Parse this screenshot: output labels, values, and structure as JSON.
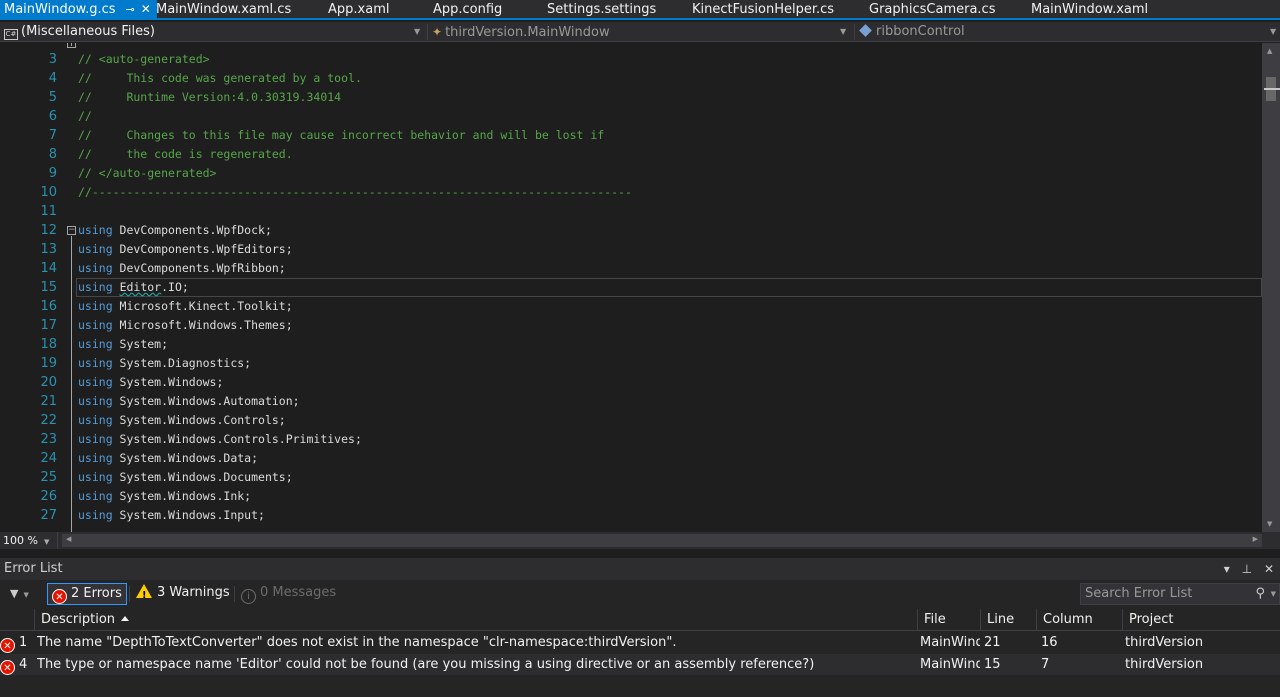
{
  "tabs": [
    {
      "label": "MainWindow.g.cs",
      "active": true
    },
    {
      "label": "MainWindow.xaml.cs"
    },
    {
      "label": "App.xaml"
    },
    {
      "label": "App.config"
    },
    {
      "label": "Settings.settings"
    },
    {
      "label": "KinectFusionHelper.cs"
    },
    {
      "label": "GraphicsCamera.cs"
    },
    {
      "label": "MainWindow.xaml"
    }
  ],
  "tab_pin_glyph": "⊸",
  "tab_close_glyph": "✕",
  "navbar": {
    "project_icon_text": "C#",
    "project": "(Miscellaneous Files)",
    "type": "thirdVersion.MainWindow",
    "member": "ribbonControl"
  },
  "editor": {
    "lines": [
      {
        "num": "3",
        "parts": [
          {
            "c": "cm",
            "t": "// <auto-generated>"
          }
        ]
      },
      {
        "num": "4",
        "parts": [
          {
            "c": "cm",
            "t": "//     This code was generated by a tool."
          }
        ]
      },
      {
        "num": "5",
        "parts": [
          {
            "c": "cm",
            "t": "//     Runtime Version:4.0.30319.34014"
          }
        ]
      },
      {
        "num": "6",
        "parts": [
          {
            "c": "cm",
            "t": "//"
          }
        ]
      },
      {
        "num": "7",
        "parts": [
          {
            "c": "cm",
            "t": "//     Changes to this file may cause incorrect behavior and will be lost if"
          }
        ]
      },
      {
        "num": "8",
        "parts": [
          {
            "c": "cm",
            "t": "//     the code is regenerated."
          }
        ]
      },
      {
        "num": "9",
        "parts": [
          {
            "c": "cm",
            "t": "// </auto-generated>"
          }
        ]
      },
      {
        "num": "10",
        "parts": [
          {
            "c": "cm",
            "t": "//------------------------------------------------------------------------------"
          }
        ]
      },
      {
        "num": "11",
        "parts": []
      },
      {
        "num": "12",
        "parts": [
          {
            "c": "kw",
            "t": "using"
          },
          {
            "c": "",
            "t": " DevComponents.WpfDock;"
          }
        ]
      },
      {
        "num": "13",
        "parts": [
          {
            "c": "kw",
            "t": "using"
          },
          {
            "c": "",
            "t": " DevComponents.WpfEditors;"
          }
        ]
      },
      {
        "num": "14",
        "parts": [
          {
            "c": "kw",
            "t": "using"
          },
          {
            "c": "",
            "t": " DevComponents.WpfRibbon;"
          }
        ]
      },
      {
        "num": "15",
        "parts": [
          {
            "c": "kw",
            "t": "using"
          },
          {
            "c": "",
            "t": " "
          },
          {
            "c": "sq",
            "t": "Editor"
          },
          {
            "c": "",
            "t": ".IO;"
          }
        ],
        "current": true
      },
      {
        "num": "16",
        "parts": [
          {
            "c": "kw",
            "t": "using"
          },
          {
            "c": "",
            "t": " Microsoft.Kinect.Toolkit;"
          }
        ]
      },
      {
        "num": "17",
        "parts": [
          {
            "c": "kw",
            "t": "using"
          },
          {
            "c": "",
            "t": " Microsoft.Windows.Themes;"
          }
        ]
      },
      {
        "num": "18",
        "parts": [
          {
            "c": "kw",
            "t": "using"
          },
          {
            "c": "",
            "t": " System;"
          }
        ]
      },
      {
        "num": "19",
        "parts": [
          {
            "c": "kw",
            "t": "using"
          },
          {
            "c": "",
            "t": " System.Diagnostics;"
          }
        ]
      },
      {
        "num": "20",
        "parts": [
          {
            "c": "kw",
            "t": "using"
          },
          {
            "c": "",
            "t": " System.Windows;"
          }
        ]
      },
      {
        "num": "21",
        "parts": [
          {
            "c": "kw",
            "t": "using"
          },
          {
            "c": "",
            "t": " System.Windows.Automation;"
          }
        ]
      },
      {
        "num": "22",
        "parts": [
          {
            "c": "kw",
            "t": "using"
          },
          {
            "c": "",
            "t": " System.Windows.Controls;"
          }
        ]
      },
      {
        "num": "23",
        "parts": [
          {
            "c": "kw",
            "t": "using"
          },
          {
            "c": "",
            "t": " System.Windows.Controls.Primitives;"
          }
        ]
      },
      {
        "num": "24",
        "parts": [
          {
            "c": "kw",
            "t": "using"
          },
          {
            "c": "",
            "t": " System.Windows.Data;"
          }
        ]
      },
      {
        "num": "25",
        "parts": [
          {
            "c": "kw",
            "t": "using"
          },
          {
            "c": "",
            "t": " System.Windows.Documents;"
          }
        ]
      },
      {
        "num": "26",
        "parts": [
          {
            "c": "kw",
            "t": "using"
          },
          {
            "c": "",
            "t": " System.Windows.Ink;"
          }
        ]
      },
      {
        "num": "27",
        "parts": [
          {
            "c": "kw",
            "t": "using"
          },
          {
            "c": "",
            "t": " System.Windows.Input;"
          }
        ]
      }
    ]
  },
  "zoom": "100 %",
  "error_list": {
    "title": "Error List",
    "errors_label": "2 Errors",
    "warnings_label": "3 Warnings",
    "messages_label": "0 Messages",
    "search_placeholder": "Search Error List",
    "columns": {
      "description": "Description",
      "file": "File",
      "line": "Line",
      "column": "Column",
      "project": "Project"
    },
    "rows": [
      {
        "num": "1",
        "description": "The name \"DepthToTextConverter\" does not exist in the namespace \"clr-namespace:thirdVersion\".",
        "file": "MainWind",
        "line": "21",
        "column": "16",
        "project": "thirdVersion"
      },
      {
        "num": "4",
        "description": "The type or namespace name 'Editor' could not be found (are you missing a using directive or an assembly reference?)",
        "file": "MainWind",
        "line": "15",
        "column": "7",
        "project": "thirdVersion"
      }
    ]
  },
  "colors": {
    "accent": "#007acc",
    "comment": "#57a64a",
    "keyword": "#569cd6",
    "line_number": "#2b91af",
    "error": "#e51400",
    "warning": "#ffcc00"
  }
}
